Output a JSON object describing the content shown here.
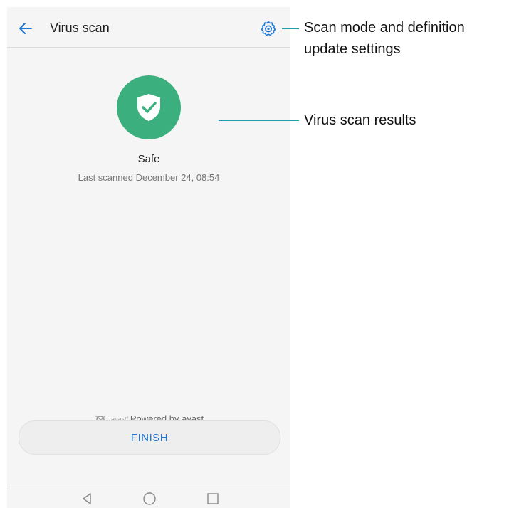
{
  "app": {
    "title": "Virus scan"
  },
  "icons": {
    "back": "back-arrow-icon",
    "settings": "gear-icon",
    "status": "shield-check-icon",
    "nav_back": "triangle-back-icon",
    "nav_home": "circle-home-icon",
    "nav_recent": "square-recent-icon"
  },
  "scan": {
    "status": "Safe",
    "last_scanned": "Last scanned December 24, 08:54"
  },
  "footer": {
    "logo_word": "avast!",
    "powered_by": "Powered by avast",
    "finish_label": "FINISH"
  },
  "annotations": {
    "settings_line1": "Scan mode and definition",
    "settings_line2": "update settings",
    "results": "Virus scan results"
  },
  "colors": {
    "accent_blue": "#1e78d4",
    "safe_green": "#3caf7e",
    "callout_teal": "#1fa0a8"
  }
}
